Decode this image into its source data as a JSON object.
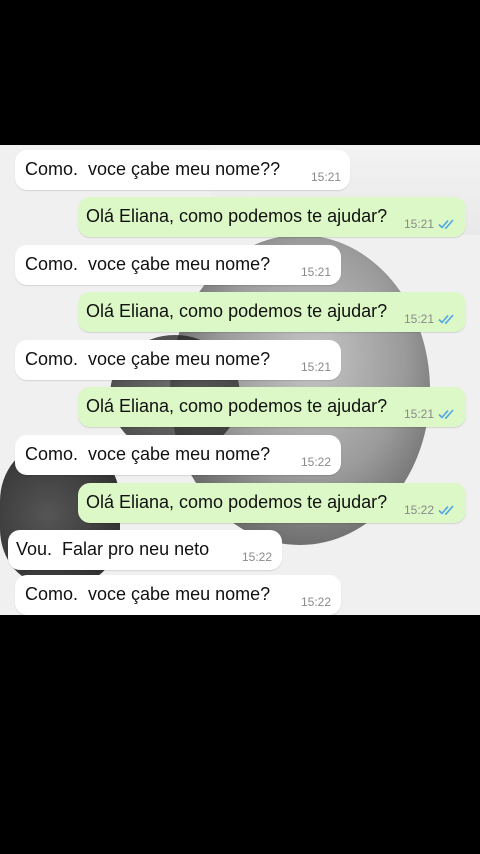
{
  "messages": [
    {
      "dir": "in",
      "text": "Como.  voce çabe meu nome??",
      "time": "15:21"
    },
    {
      "dir": "out",
      "text": "Olá Eliana, como podemos te ajudar?",
      "time": "15:21",
      "status": "read"
    },
    {
      "dir": "in",
      "text": "Como.  voce çabe meu nome?",
      "time": "15:21"
    },
    {
      "dir": "out",
      "text": "Olá Eliana, como podemos te ajudar?",
      "time": "15:21",
      "status": "read"
    },
    {
      "dir": "in",
      "text": "Como.  voce çabe meu nome?",
      "time": "15:21"
    },
    {
      "dir": "out",
      "text": "Olá Eliana, como podemos te ajudar?",
      "time": "15:21",
      "status": "read"
    },
    {
      "dir": "in",
      "text": "Como.  voce çabe meu nome?",
      "time": "15:22"
    },
    {
      "dir": "out",
      "text": "Olá Eliana, como podemos te ajudar?",
      "time": "15:22",
      "status": "read"
    },
    {
      "dir": "in",
      "text": "Vou.  Falar pro neu neto",
      "time": "15:22"
    },
    {
      "dir": "in",
      "text": "Como.  voce çabe meu nome?",
      "time": "15:22"
    }
  ],
  "colors": {
    "incoming": "#ffffff",
    "outgoing": "#dcf8c6",
    "read_ticks": "#4fa6e8"
  },
  "icons": {
    "read_status": "double-check-icon"
  }
}
